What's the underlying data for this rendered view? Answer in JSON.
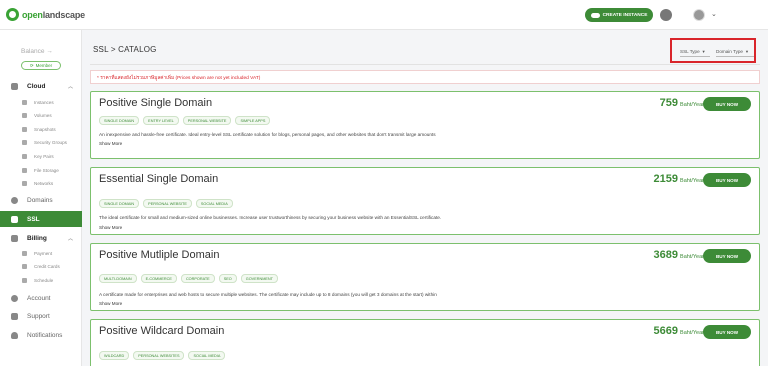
{
  "header": {
    "logo_green": "open",
    "logo_dark": "landscape",
    "create_label": "CREATE INSTANCE",
    "user_chevron": "⌄"
  },
  "sidebar": {
    "balance": "Balance →",
    "member": "Member",
    "cloud": "Cloud",
    "cloud_items": [
      "Instances",
      "Volumes",
      "Snapshots",
      "Security Groups",
      "Key Pairs",
      "File Storage",
      "Networks"
    ],
    "domains": "Domains",
    "ssl": "SSL",
    "billing": "Billing",
    "billing_items": [
      "Payment",
      "Credit Cards",
      "Schedule"
    ],
    "account": "Account",
    "support": "Support",
    "notifications": "Notifications"
  },
  "page": {
    "breadcrumb": "SSL > CATALOG",
    "filter_ssl": "SSL Type",
    "filter_domain": "Domain Type",
    "note": "* ราคาที่แสดงยังไม่รวมภาษีมูลค่าเพิ่ม (Prices shown are not yet included VAT)"
  },
  "cards": [
    {
      "title": "Positive Single Domain",
      "price": "759",
      "unit": "Baht/Year",
      "buy": "BUY NOW",
      "tags": [
        "SINGLE DOMAIN",
        "ENTRY LEVEL",
        "PERSONAL WEBSITE",
        "SIMPLE APPS"
      ],
      "desc": "An inexpensive and hassle-free certificate. Ideal entry-level SSL certificate solution for blogs, personal pages, and other websites that don't transmit large amounts",
      "more": "Show More"
    },
    {
      "title": "Essential Single Domain",
      "price": "2159",
      "unit": "Baht/Year",
      "buy": "BUY NOW",
      "tags": [
        "SINGLE DOMAIN",
        "PERSONAL WEBSITE",
        "SOCIAL MEDIA"
      ],
      "desc": "The ideal certificate for small and medium-sized online businesses. Increase user trustworthiness by securing your business website with an EssentialSSL certificate.",
      "more": "Show More"
    },
    {
      "title": "Positive Mutliple Domain",
      "price": "3689",
      "unit": "Baht/Year",
      "buy": "BUY NOW",
      "tags": [
        "MULTI-DOMAIN",
        "E-COMMERCE",
        "CORPORATE",
        "SEO",
        "GOVERNMENT"
      ],
      "desc": "A certificate made for enterprises and web hosts to secure multiple websites. The certificate may include up to 8 domains (you will get 3 domains at the start) within",
      "more": "Show More"
    },
    {
      "title": "Positive Wildcard Domain",
      "price": "5669",
      "unit": "Baht/Year",
      "buy": "BUY NOW",
      "tags": [
        "WILDCARD",
        "PERSONAL WEBSITES",
        "SOCIAL MEDIA"
      ],
      "desc": "",
      "more": ""
    }
  ],
  "colors": {
    "brand_green": "#3d8b37",
    "highlight_red": "#d9252b"
  }
}
